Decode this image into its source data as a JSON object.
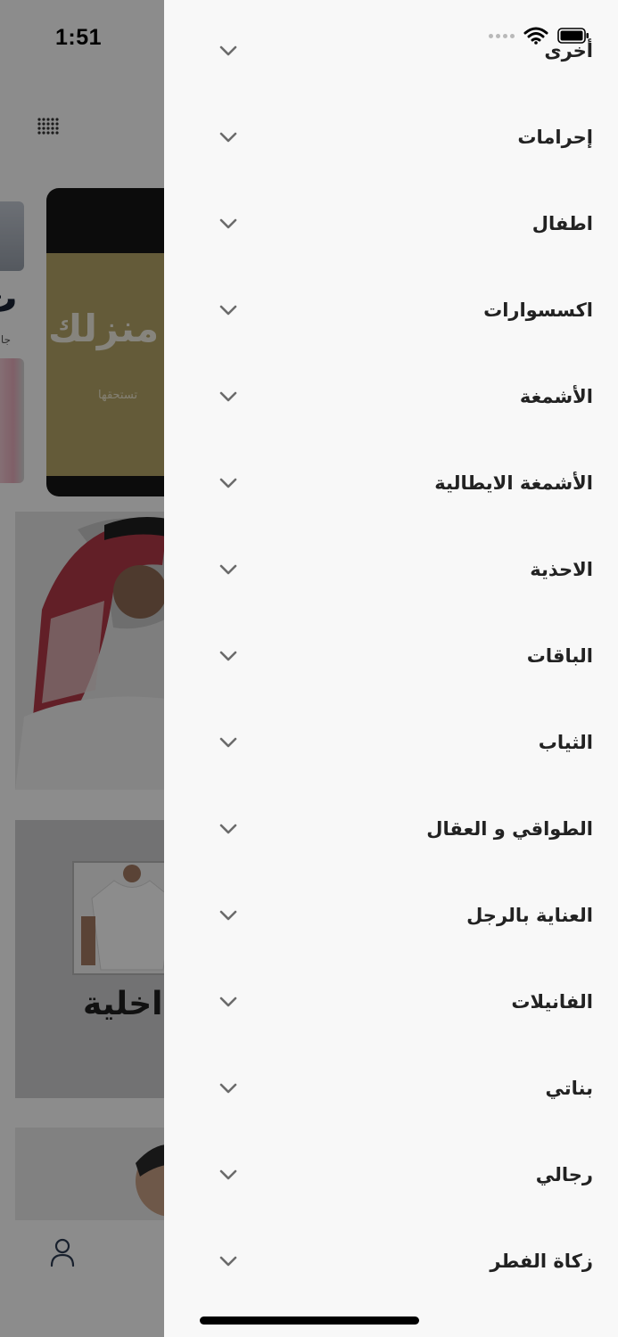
{
  "status_bar": {
    "time": "1:51"
  },
  "background": {
    "banner_title": "منزلك",
    "banner_subtitle": "تستحقها",
    "side_banner_letter": "ث",
    "side_banner_sub": "جا",
    "undershirt_caption": "داخلية"
  },
  "drawer": {
    "menu_items": [
      {
        "label": "أخرى",
        "icon": "chevron-down-icon"
      },
      {
        "label": "إحرامات",
        "icon": "chevron-down-icon"
      },
      {
        "label": "اطفال",
        "icon": "chevron-down-icon"
      },
      {
        "label": "اكسسوارات",
        "icon": "chevron-down-icon"
      },
      {
        "label": "الأشمغة",
        "icon": "chevron-down-icon"
      },
      {
        "label": "الأشمغة الايطالية",
        "icon": "chevron-down-icon"
      },
      {
        "label": "الاحذية",
        "icon": "chevron-down-icon"
      },
      {
        "label": "الباقات",
        "icon": "chevron-down-icon"
      },
      {
        "label": "الثياب",
        "icon": "chevron-down-icon"
      },
      {
        "label": "الطواقي و العقال",
        "icon": "chevron-down-icon"
      },
      {
        "label": "العناية بالرجل",
        "icon": "chevron-down-icon"
      },
      {
        "label": "الفانيلات",
        "icon": "chevron-down-icon"
      },
      {
        "label": "بناتي",
        "icon": "chevron-down-icon"
      },
      {
        "label": "رجالي",
        "icon": "chevron-down-icon"
      },
      {
        "label": "زكاة الفطر",
        "icon": "chevron-down-icon"
      }
    ]
  },
  "colors": {
    "drawer_bg": "#f8f8f8",
    "text": "#222222",
    "chevron": "#6b6b6b"
  }
}
